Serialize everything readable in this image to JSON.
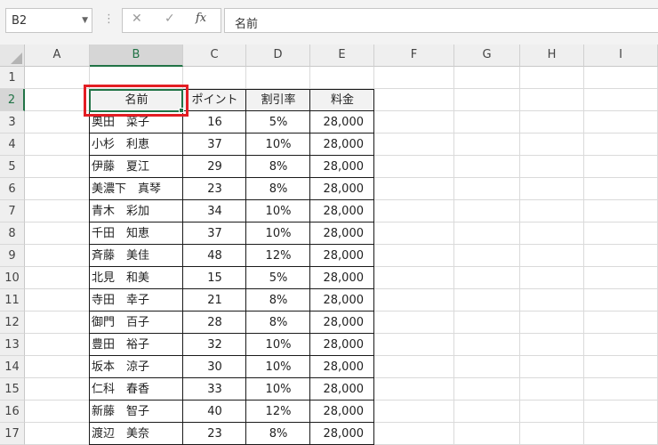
{
  "formula_bar": {
    "name_box": "B2",
    "cancel_icon": "✕",
    "enter_icon": "✓",
    "fx_label": "fx",
    "formula_value": "名前"
  },
  "columns": [
    "A",
    "B",
    "C",
    "D",
    "E",
    "F",
    "G",
    "H",
    "I"
  ],
  "rows": [
    "1",
    "2",
    "3",
    "4",
    "5",
    "6",
    "7",
    "8",
    "9",
    "10",
    "11",
    "12",
    "13",
    "14",
    "15",
    "16",
    "17"
  ],
  "selected": {
    "cell": "B2",
    "column": "B",
    "row": "2"
  },
  "table": {
    "headers": [
      "名前",
      "ポイント",
      "割引率",
      "料金"
    ],
    "records": [
      [
        "奥田　菜子",
        "16",
        "5%",
        "28,000"
      ],
      [
        "小杉　利恵",
        "37",
        "10%",
        "28,000"
      ],
      [
        "伊藤　夏江",
        "29",
        "8%",
        "28,000"
      ],
      [
        "美濃下　真琴",
        "23",
        "8%",
        "28,000"
      ],
      [
        "青木　彩加",
        "34",
        "10%",
        "28,000"
      ],
      [
        "千田　知恵",
        "37",
        "10%",
        "28,000"
      ],
      [
        "斉藤　美佳",
        "48",
        "12%",
        "28,000"
      ],
      [
        "北見　和美",
        "15",
        "5%",
        "28,000"
      ],
      [
        "寺田　幸子",
        "21",
        "8%",
        "28,000"
      ],
      [
        "御門　百子",
        "28",
        "8%",
        "28,000"
      ],
      [
        "豊田　裕子",
        "32",
        "10%",
        "28,000"
      ],
      [
        "坂本　涼子",
        "30",
        "10%",
        "28,000"
      ],
      [
        "仁科　春香",
        "33",
        "10%",
        "28,000"
      ],
      [
        "新藤　智子",
        "40",
        "12%",
        "28,000"
      ],
      [
        "渡辺　美奈",
        "23",
        "8%",
        "28,000"
      ]
    ]
  },
  "colors": {
    "accent": "#217346",
    "highlight": "#e31e24"
  }
}
